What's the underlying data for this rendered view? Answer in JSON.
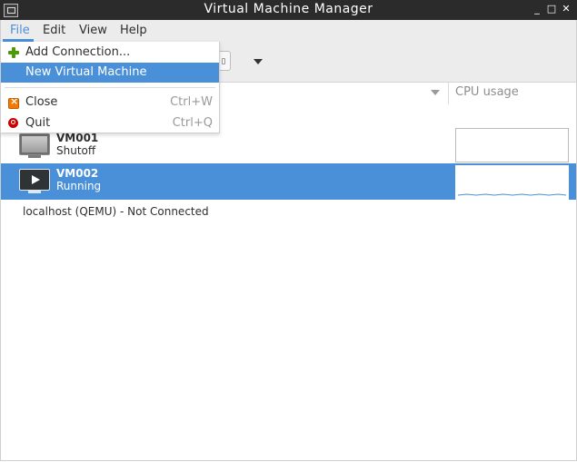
{
  "window": {
    "title": "Virtual Machine Manager",
    "controls": {
      "minimize": "_",
      "maximize": "□",
      "close": "✕"
    }
  },
  "menubar": {
    "items": [
      "File",
      "Edit",
      "View",
      "Help"
    ],
    "active": "File"
  },
  "file_menu": {
    "items": [
      {
        "label": "Add Connection...",
        "icon": "add-icon",
        "accel": ""
      },
      {
        "label": "New Virtual Machine",
        "icon": "",
        "accel": "",
        "highlighted": true
      },
      {
        "label": "Close",
        "icon": "close-icon",
        "accel": "Ctrl+W"
      },
      {
        "label": "Quit",
        "icon": "quit-icon",
        "accel": "Ctrl+Q"
      }
    ]
  },
  "table": {
    "cpu_header": "CPU usage"
  },
  "vms": [
    {
      "name": "VM001",
      "state": "Shutoff",
      "selected": false
    },
    {
      "name": "VM002",
      "state": "Running",
      "selected": true
    }
  ],
  "connection": {
    "label": "localhost (QEMU) - Not Connected"
  },
  "colors": {
    "accent": "#4a90d9",
    "titlebar": "#2b2b2b"
  }
}
